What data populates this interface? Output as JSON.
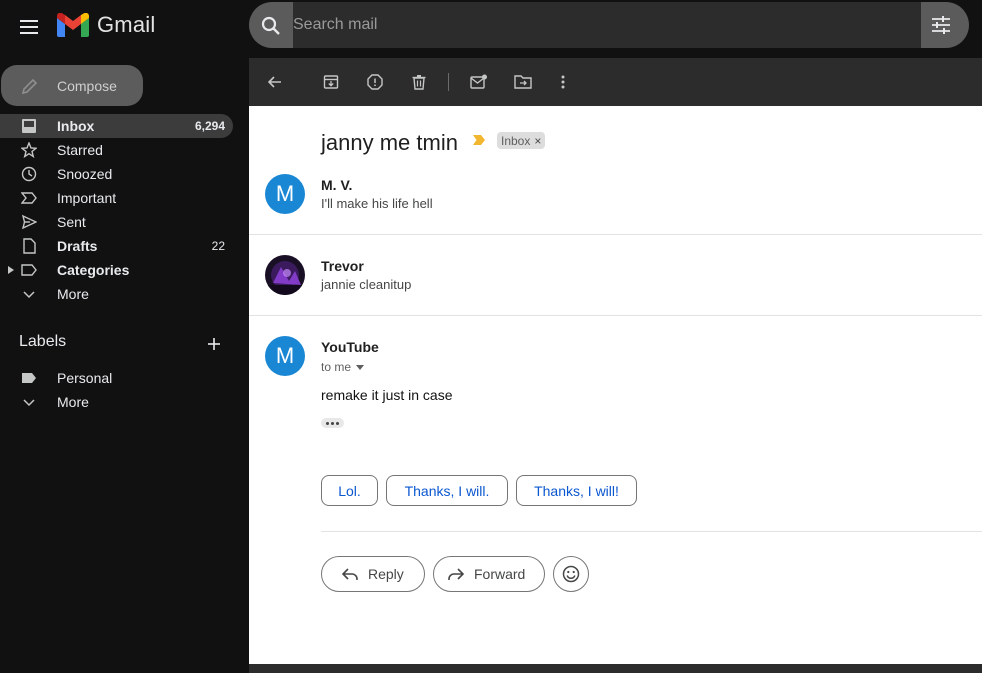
{
  "app": {
    "name": "Gmail",
    "brand_colors": {
      "red": "#ea4335",
      "blue": "#4285f4",
      "green": "#34a853",
      "yellow": "#fbbc04"
    }
  },
  "search": {
    "placeholder": "Search mail",
    "value": ""
  },
  "compose": {
    "label": "Compose"
  },
  "sidebar": {
    "items": [
      {
        "label": "Inbox",
        "count": "6,294",
        "icon": "inbox-icon",
        "active": true,
        "bold": true
      },
      {
        "label": "Starred",
        "count": "",
        "icon": "star-icon"
      },
      {
        "label": "Snoozed",
        "count": "",
        "icon": "clock-icon"
      },
      {
        "label": "Important",
        "count": "",
        "icon": "important-icon"
      },
      {
        "label": "Sent",
        "count": "",
        "icon": "send-icon"
      },
      {
        "label": "Drafts",
        "count": "22",
        "icon": "draft-icon",
        "bold": true
      },
      {
        "label": "Categories",
        "count": "",
        "icon": "label-icon",
        "bold": true
      },
      {
        "label": "More",
        "count": "",
        "icon": "chevron-down-icon"
      }
    ],
    "labels_heading": "Labels",
    "labels": [
      {
        "label": "Personal",
        "icon": "label-filled-icon"
      },
      {
        "label": "More",
        "icon": "chevron-down-icon"
      }
    ]
  },
  "toolbar": {
    "icons": [
      "back-icon",
      "archive-icon",
      "report-spam-icon",
      "delete-icon",
      "mark-unread-icon",
      "move-to-icon",
      "more-vert-icon"
    ]
  },
  "thread": {
    "subject": "janny me tmin",
    "label_chip": "Inbox",
    "label_chip_close": "×",
    "messages": [
      {
        "avatar_letter": "M",
        "sender": "M. V.",
        "snippet": "I'll make his life hell"
      },
      {
        "avatar_letter": "",
        "sender": "Trevor",
        "snippet": "jannie cleanitup"
      },
      {
        "avatar_letter": "M",
        "sender": "YouTube",
        "to_line": "to me",
        "body": "remake it just in case"
      }
    ],
    "smart_replies": [
      "Lol.",
      "Thanks, I will.",
      "Thanks, I will!"
    ],
    "actions": {
      "reply": "Reply",
      "forward": "Forward"
    }
  }
}
